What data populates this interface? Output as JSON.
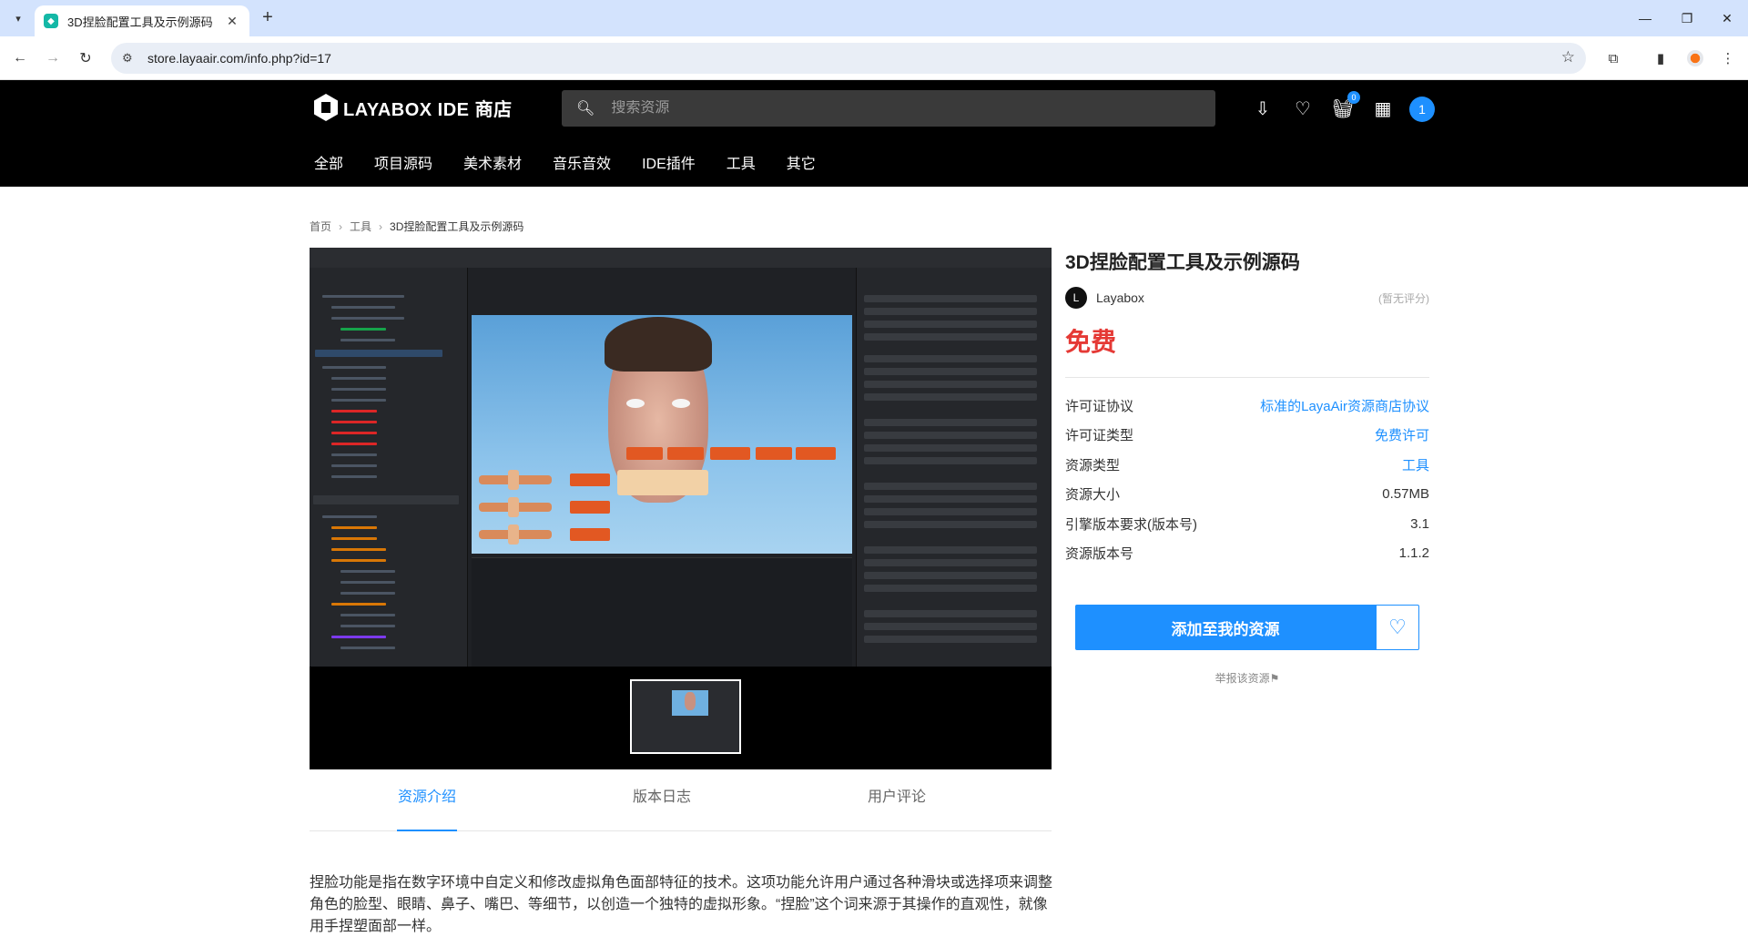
{
  "browser": {
    "tab_title": "3D捏脸配置工具及示例源码",
    "url": "store.layaair.com/info.php?id=17"
  },
  "header": {
    "logo_text": "LAYABOX IDE 商店",
    "search_placeholder": "搜索资源",
    "cart_count": "0",
    "user_initial": "1",
    "categories": [
      "全部",
      "项目源码",
      "美术素材",
      "音乐音效",
      "IDE插件",
      "工具",
      "其它"
    ]
  },
  "breadcrumb": {
    "home": "首页",
    "category": "工具",
    "current": "3D捏脸配置工具及示例源码"
  },
  "tabs": [
    "资源介绍",
    "版本日志",
    "用户评论"
  ],
  "description": "捏脸功能是指在数字环境中自定义和修改虚拟角色面部特征的技术。这项功能允许用户通过各种滑块或选择项来调整角色的脸型、眼睛、鼻子、嘴巴、等细节，以创造一个独特的虚拟形象。“捏脸”这个词来源于其操作的直观性，就像用手捏塑面部一样。",
  "resource": {
    "title": "3D捏脸配置工具及示例源码",
    "author_initial": "L",
    "author": "Layabox",
    "rating": "(暂无评分)",
    "price": "免费",
    "meta": [
      {
        "key": "许可证协议",
        "value": "标准的LayaAir资源商店协议",
        "link": true
      },
      {
        "key": "许可证类型",
        "value": "免费许可",
        "link": true
      },
      {
        "key": "资源类型",
        "value": "工具",
        "link": true
      },
      {
        "key": "资源大小",
        "value": "0.57MB",
        "link": false
      },
      {
        "key": "引擎版本要求(版本号)",
        "value": "3.1",
        "link": false
      },
      {
        "key": "资源版本号",
        "value": "1.1.2",
        "link": false
      }
    ],
    "add_button": "添加至我的资源",
    "report": "举报该资源⚑"
  },
  "colors": {
    "accent": "#1e90ff",
    "price": "#e53935",
    "header_bg": "#000000"
  }
}
